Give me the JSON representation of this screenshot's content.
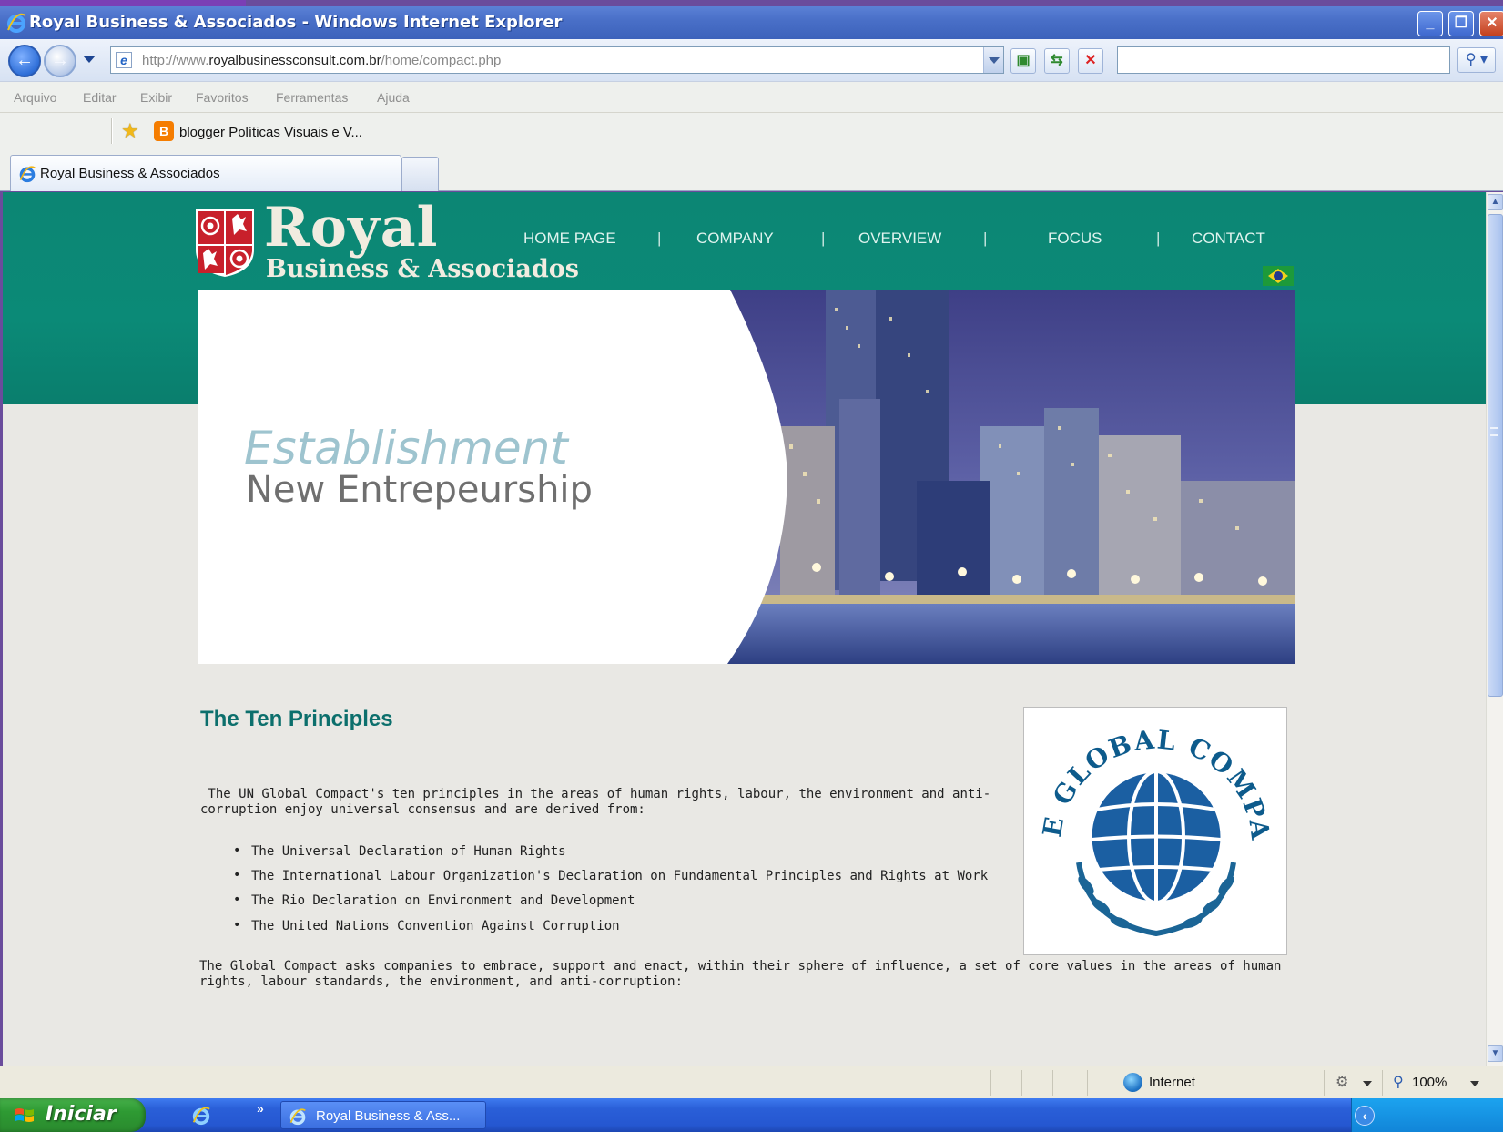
{
  "window": {
    "title": "Royal Business & Associados - Windows Internet Explorer",
    "min_glyph": "_",
    "max_glyph": "❐",
    "close_glyph": "✕"
  },
  "address_bar": {
    "url_prefix": "http://www.",
    "url_domain": "royalbusinessconsult.com.br",
    "url_path": "/home/compact.php",
    "search_value": ""
  },
  "menu": [
    "Arquivo",
    "Editar",
    "Exibir",
    "Favoritos",
    "Ferramentas",
    "Ajuda"
  ],
  "favorites": {
    "item_label": "blogger Políticas Visuais e V..."
  },
  "tabs": {
    "active_label": "Royal Business & Associados"
  },
  "site": {
    "logo_title": "Royal",
    "logo_subtitle": "Business & Associados",
    "nav": [
      "HOME PAGE",
      "COMPANY",
      "OVERVIEW",
      "FOCUS",
      "CONTACT"
    ],
    "nav_separator": "|",
    "hero_line1": "Establishment",
    "hero_line2": "New Entrepeurship",
    "section_title": "The Ten Principles",
    "intro": " The UN Global Compact's ten principles in the areas of human rights, labour, the environment and anti-corruption enjoy universal consensus and are derived from:",
    "intro_line1": " The UN Global Compact's ten principles in the areas of human rights, labour, the environment and anti-",
    "intro_line2": "corruption enjoy universal consensus and are derived from:",
    "sources": [
      "The Universal Declaration of Human Rights",
      "The International Labour Organization's Declaration on Fundamental Principles and Rights at Work",
      "The Rio Declaration on Environment and Development",
      "The United Nations Convention Against Corruption"
    ],
    "bullet_glyph": "•",
    "closing_line1": "The Global Compact asks companies to embrace, support and enact, within their sphere of influence, a set of core values in the areas of human",
    "closing_line2": "rights, labour standards, the environment, and anti-corruption:",
    "gc_logo_text": "THE GLOBAL COMPACT",
    "colors": {
      "teal": "#0b8a77",
      "heading": "#0c6f6c"
    }
  },
  "status_bar": {
    "zone": "Internet",
    "zoom": "100%"
  },
  "taskbar": {
    "start_label": "Iniciar",
    "task_label": "Royal Business & Ass...",
    "more_glyph": "»"
  }
}
